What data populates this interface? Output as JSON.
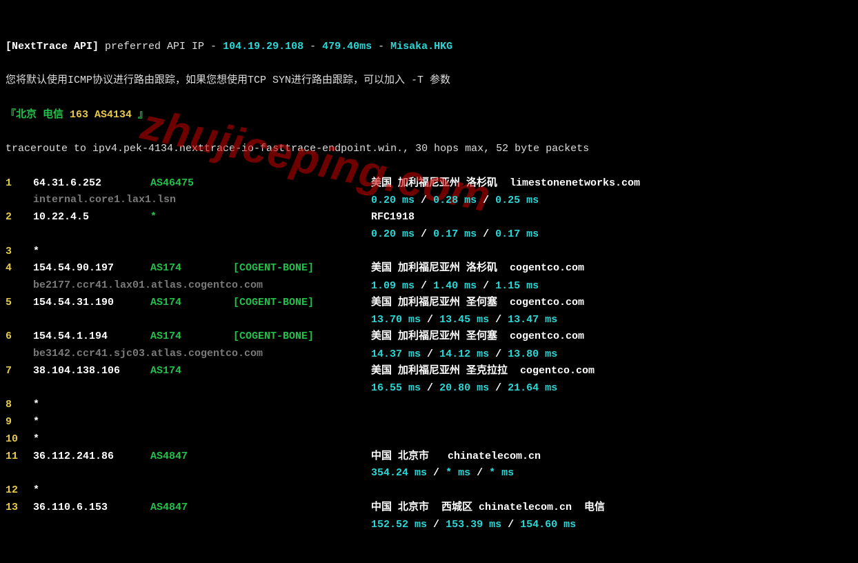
{
  "header": {
    "api_label": "[NextTrace API]",
    "api_text": " preferred API IP - ",
    "api_ip": "104.19.29.108",
    "api_sep": " - ",
    "api_ms": "479.40ms",
    "api_sep2": " - ",
    "api_loc": "Misaka.HKG"
  },
  "hint": "您将默认使用ICMP协议进行路由跟踪，如果您想使用TCP SYN进行路由跟踪，可以加入 -T 参数",
  "route_title": {
    "b1": "『",
    "city": "北京 电信 ",
    "asn": "163 AS4134",
    "b2": " 』"
  },
  "trace_cmd": "traceroute to ipv4.pek-4134.nexttrace-io-fasttrace-endpoint.win., 30 hops max, 52 byte packets",
  "hops": [
    {
      "n": "1",
      "ip": "64.31.6.252",
      "asn": "AS46475",
      "tag": "",
      "loc": "美国 加利福尼亚州 洛杉矶  limestonenetworks.com",
      "host": "internal.core1.lax1.lsn",
      "rtt": [
        "0.20 ms",
        "0.28 ms",
        "0.25 ms"
      ]
    },
    {
      "n": "2",
      "ip": "10.22.4.5",
      "asn": "*",
      "tag": "",
      "loc": "RFC1918",
      "host": "",
      "rtt": [
        "0.20 ms",
        "0.17 ms",
        "0.17 ms"
      ]
    },
    {
      "n": "3",
      "ip": "*",
      "asn": "",
      "tag": "",
      "loc": "",
      "host": "",
      "rtt": []
    },
    {
      "n": "4",
      "ip": "154.54.90.197",
      "asn": "AS174",
      "tag": "[COGENT-BONE]",
      "loc": "美国 加利福尼亚州 洛杉矶  cogentco.com",
      "host": "be2177.ccr41.lax01.atlas.cogentco.com",
      "rtt": [
        "1.09 ms",
        "1.40 ms",
        "1.15 ms"
      ]
    },
    {
      "n": "5",
      "ip": "154.54.31.190",
      "asn": "AS174",
      "tag": "[COGENT-BONE]",
      "loc": "美国 加利福尼亚州 圣何塞  cogentco.com",
      "host": "",
      "rtt": [
        "13.70 ms",
        "13.45 ms",
        "13.47 ms"
      ]
    },
    {
      "n": "6",
      "ip": "154.54.1.194",
      "asn": "AS174",
      "tag": "[COGENT-BONE]",
      "loc": "美国 加利福尼亚州 圣何塞  cogentco.com",
      "host": "be3142.ccr41.sjc03.atlas.cogentco.com",
      "rtt": [
        "14.37 ms",
        "14.12 ms",
        "13.80 ms"
      ]
    },
    {
      "n": "7",
      "ip": "38.104.138.106",
      "asn": "AS174",
      "tag": "",
      "loc": "美国 加利福尼亚州 圣克拉拉  cogentco.com",
      "host": "",
      "rtt": [
        "16.55 ms",
        "20.80 ms",
        "21.64 ms"
      ]
    },
    {
      "n": "8",
      "ip": "*",
      "asn": "",
      "tag": "",
      "loc": "",
      "host": "",
      "rtt": []
    },
    {
      "n": "9",
      "ip": "*",
      "asn": "",
      "tag": "",
      "loc": "",
      "host": "",
      "rtt": []
    },
    {
      "n": "10",
      "ip": "*",
      "asn": "",
      "tag": "",
      "loc": "",
      "host": "",
      "rtt": []
    },
    {
      "n": "11",
      "ip": "36.112.241.86",
      "asn": "AS4847",
      "tag": "",
      "loc": "中国 北京市   chinatelecom.cn",
      "host": "",
      "rtt": [
        "354.24 ms",
        "* ms",
        "* ms"
      ]
    },
    {
      "n": "12",
      "ip": "*",
      "asn": "",
      "tag": "",
      "loc": "",
      "host": "",
      "rtt": []
    },
    {
      "n": "13",
      "ip": "36.110.6.153",
      "asn": "AS4847",
      "tag": "",
      "loc": "中国 北京市  西城区 chinatelecom.cn  电信",
      "host": "",
      "rtt": [
        "152.52 ms",
        "153.39 ms",
        "154.60 ms"
      ]
    }
  ],
  "watermark": "zhujiceping.com"
}
